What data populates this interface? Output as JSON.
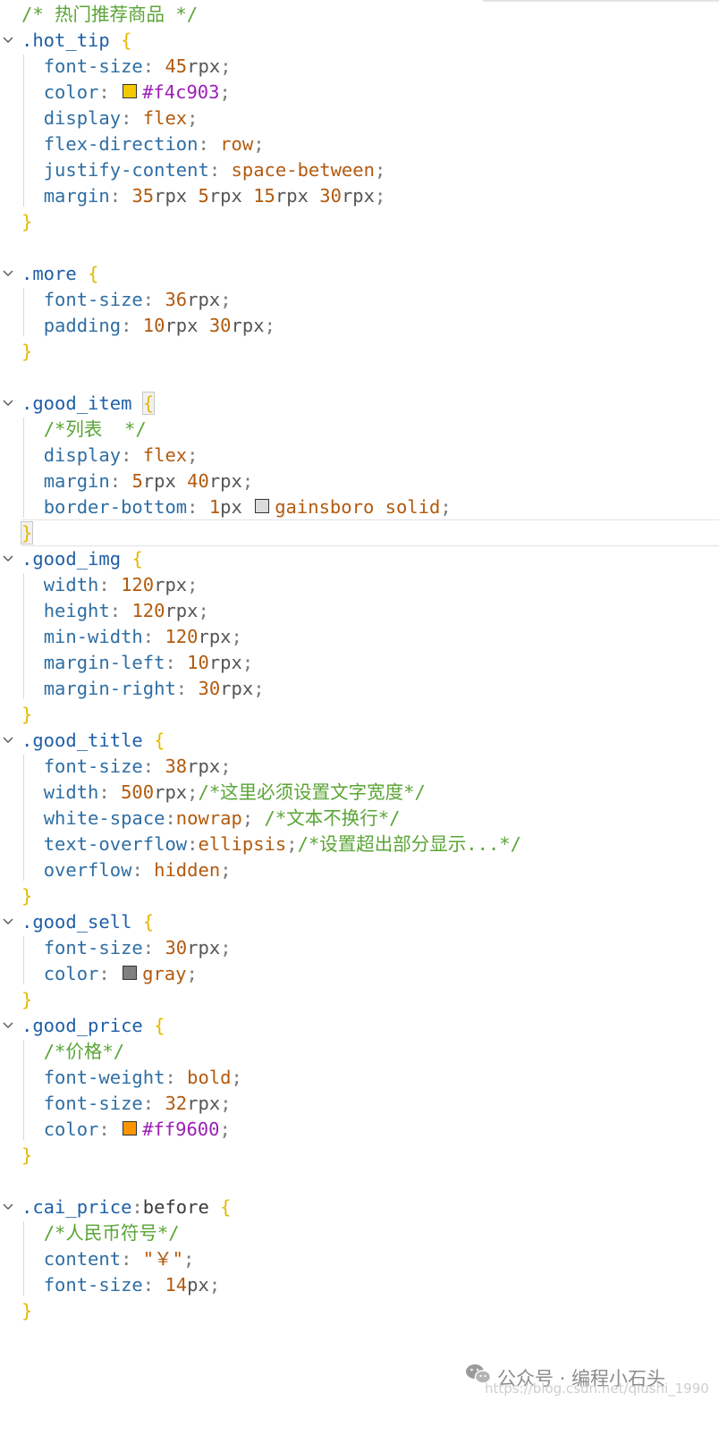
{
  "lines": [
    {
      "top": 0,
      "fold": false,
      "segs": [
        [
          "c-comment",
          "/* 热门推荐商品 */"
        ]
      ]
    },
    {
      "top": 0,
      "fold": true,
      "segs": [
        [
          "c-selector",
          ".hot_tip"
        ],
        [
          "c-plain",
          " "
        ],
        [
          "c-brace",
          "{"
        ]
      ]
    },
    {
      "top": 0,
      "fold": false,
      "segs": [
        [
          "c-plain",
          "  "
        ],
        [
          "c-prop",
          "font-size"
        ],
        [
          "c-punct",
          ": "
        ],
        [
          "c-number",
          "45"
        ],
        [
          "c-unit",
          "rpx"
        ],
        [
          "c-punct",
          ";"
        ]
      ]
    },
    {
      "top": 0,
      "fold": false,
      "segs": [
        [
          "c-plain",
          "  "
        ],
        [
          "c-prop",
          "color"
        ],
        [
          "c-punct",
          ": "
        ],
        [
          "swatch",
          "#f4c903"
        ],
        [
          "c-hex",
          "#f4c903"
        ],
        [
          "c-punct",
          ";"
        ]
      ]
    },
    {
      "top": 0,
      "fold": false,
      "segs": [
        [
          "c-plain",
          "  "
        ],
        [
          "c-prop",
          "display"
        ],
        [
          "c-punct",
          ": "
        ],
        [
          "c-value",
          "flex"
        ],
        [
          "c-punct",
          ";"
        ]
      ]
    },
    {
      "top": 0,
      "fold": false,
      "segs": [
        [
          "c-plain",
          "  "
        ],
        [
          "c-prop",
          "flex-direction"
        ],
        [
          "c-punct",
          ": "
        ],
        [
          "c-value",
          "row"
        ],
        [
          "c-punct",
          ";"
        ]
      ]
    },
    {
      "top": 0,
      "fold": false,
      "segs": [
        [
          "c-plain",
          "  "
        ],
        [
          "c-prop",
          "justify-content"
        ],
        [
          "c-punct",
          ": "
        ],
        [
          "c-value",
          "space-between"
        ],
        [
          "c-punct",
          ";"
        ]
      ]
    },
    {
      "top": 0,
      "fold": false,
      "segs": [
        [
          "c-plain",
          "  "
        ],
        [
          "c-prop",
          "margin"
        ],
        [
          "c-punct",
          ": "
        ],
        [
          "c-number",
          "35"
        ],
        [
          "c-unit",
          "rpx "
        ],
        [
          "c-number",
          "5"
        ],
        [
          "c-unit",
          "rpx "
        ],
        [
          "c-number",
          "15"
        ],
        [
          "c-unit",
          "rpx "
        ],
        [
          "c-number",
          "30"
        ],
        [
          "c-unit",
          "rpx"
        ],
        [
          "c-punct",
          ";"
        ]
      ]
    },
    {
      "top": 0,
      "fold": false,
      "segs": [
        [
          "c-brace",
          "}"
        ]
      ]
    },
    {
      "top": 0,
      "fold": false,
      "segs": []
    },
    {
      "top": 0,
      "fold": true,
      "segs": [
        [
          "c-selector",
          ".more"
        ],
        [
          "c-plain",
          " "
        ],
        [
          "c-brace",
          "{"
        ]
      ]
    },
    {
      "top": 0,
      "fold": false,
      "segs": [
        [
          "c-plain",
          "  "
        ],
        [
          "c-prop",
          "font-size"
        ],
        [
          "c-punct",
          ": "
        ],
        [
          "c-number",
          "36"
        ],
        [
          "c-unit",
          "rpx"
        ],
        [
          "c-punct",
          ";"
        ]
      ]
    },
    {
      "top": 0,
      "fold": false,
      "segs": [
        [
          "c-plain",
          "  "
        ],
        [
          "c-prop",
          "padding"
        ],
        [
          "c-punct",
          ": "
        ],
        [
          "c-number",
          "10"
        ],
        [
          "c-unit",
          "rpx "
        ],
        [
          "c-number",
          "30"
        ],
        [
          "c-unit",
          "rpx"
        ],
        [
          "c-punct",
          ";"
        ]
      ]
    },
    {
      "top": 0,
      "fold": false,
      "segs": [
        [
          "c-brace",
          "}"
        ]
      ]
    },
    {
      "top": 0,
      "fold": false,
      "segs": []
    },
    {
      "top": 0,
      "fold": true,
      "segs": [
        [
          "c-selector",
          ".good_item"
        ],
        [
          "c-plain",
          " "
        ],
        [
          "c-brace-hl",
          "{"
        ]
      ]
    },
    {
      "top": 0,
      "fold": false,
      "segs": [
        [
          "c-plain",
          "  "
        ],
        [
          "c-comment",
          "/*列表  */"
        ]
      ]
    },
    {
      "top": 0,
      "fold": false,
      "segs": [
        [
          "c-plain",
          "  "
        ],
        [
          "c-prop",
          "display"
        ],
        [
          "c-punct",
          ": "
        ],
        [
          "c-value",
          "flex"
        ],
        [
          "c-punct",
          ";"
        ]
      ]
    },
    {
      "top": 0,
      "fold": false,
      "segs": [
        [
          "c-plain",
          "  "
        ],
        [
          "c-prop",
          "margin"
        ],
        [
          "c-punct",
          ": "
        ],
        [
          "c-number",
          "5"
        ],
        [
          "c-unit",
          "rpx "
        ],
        [
          "c-number",
          "40"
        ],
        [
          "c-unit",
          "rpx"
        ],
        [
          "c-punct",
          ";"
        ]
      ]
    },
    {
      "top": 0,
      "fold": false,
      "segs": [
        [
          "c-plain",
          "  "
        ],
        [
          "c-prop",
          "border-bottom"
        ],
        [
          "c-punct",
          ": "
        ],
        [
          "c-number",
          "1"
        ],
        [
          "c-unit",
          "px "
        ],
        [
          "swatch",
          "#dcdcdc"
        ],
        [
          "c-value",
          "gainsboro solid"
        ],
        [
          "c-punct",
          ";"
        ]
      ]
    },
    {
      "top": 0,
      "fold": false,
      "segs": [
        [
          "c-brace-hl",
          "}"
        ]
      ]
    },
    {
      "top": 0,
      "fold": true,
      "segs": [
        [
          "c-selector",
          ".good_img"
        ],
        [
          "c-plain",
          " "
        ],
        [
          "c-brace",
          "{"
        ]
      ]
    },
    {
      "top": 0,
      "fold": false,
      "segs": [
        [
          "c-plain",
          "  "
        ],
        [
          "c-prop",
          "width"
        ],
        [
          "c-punct",
          ": "
        ],
        [
          "c-number",
          "120"
        ],
        [
          "c-unit",
          "rpx"
        ],
        [
          "c-punct",
          ";"
        ]
      ]
    },
    {
      "top": 0,
      "fold": false,
      "segs": [
        [
          "c-plain",
          "  "
        ],
        [
          "c-prop",
          "height"
        ],
        [
          "c-punct",
          ": "
        ],
        [
          "c-number",
          "120"
        ],
        [
          "c-unit",
          "rpx"
        ],
        [
          "c-punct",
          ";"
        ]
      ]
    },
    {
      "top": 0,
      "fold": false,
      "segs": [
        [
          "c-plain",
          "  "
        ],
        [
          "c-prop",
          "min-width"
        ],
        [
          "c-punct",
          ": "
        ],
        [
          "c-number",
          "120"
        ],
        [
          "c-unit",
          "rpx"
        ],
        [
          "c-punct",
          ";"
        ]
      ]
    },
    {
      "top": 0,
      "fold": false,
      "segs": [
        [
          "c-plain",
          "  "
        ],
        [
          "c-prop",
          "margin-left"
        ],
        [
          "c-punct",
          ": "
        ],
        [
          "c-number",
          "10"
        ],
        [
          "c-unit",
          "rpx"
        ],
        [
          "c-punct",
          ";"
        ]
      ]
    },
    {
      "top": 0,
      "fold": false,
      "segs": [
        [
          "c-plain",
          "  "
        ],
        [
          "c-prop",
          "margin-right"
        ],
        [
          "c-punct",
          ": "
        ],
        [
          "c-number",
          "30"
        ],
        [
          "c-unit",
          "rpx"
        ],
        [
          "c-punct",
          ";"
        ]
      ]
    },
    {
      "top": 0,
      "fold": false,
      "segs": [
        [
          "c-brace",
          "}"
        ]
      ]
    },
    {
      "top": 0,
      "fold": true,
      "segs": [
        [
          "c-selector",
          ".good_title"
        ],
        [
          "c-plain",
          " "
        ],
        [
          "c-brace",
          "{"
        ]
      ]
    },
    {
      "top": 0,
      "fold": false,
      "segs": [
        [
          "c-plain",
          "  "
        ],
        [
          "c-prop",
          "font-size"
        ],
        [
          "c-punct",
          ": "
        ],
        [
          "c-number",
          "38"
        ],
        [
          "c-unit",
          "rpx"
        ],
        [
          "c-punct",
          ";"
        ]
      ]
    },
    {
      "top": 0,
      "fold": false,
      "segs": [
        [
          "c-plain",
          "  "
        ],
        [
          "c-prop",
          "width"
        ],
        [
          "c-punct",
          ": "
        ],
        [
          "c-number",
          "500"
        ],
        [
          "c-unit",
          "rpx"
        ],
        [
          "c-punct",
          ";"
        ],
        [
          "c-comment",
          "/*这里必须设置文字宽度*/"
        ]
      ]
    },
    {
      "top": 0,
      "fold": false,
      "segs": [
        [
          "c-plain",
          "  "
        ],
        [
          "c-prop",
          "white-space"
        ],
        [
          "c-punct",
          ":"
        ],
        [
          "c-value",
          "nowrap"
        ],
        [
          "c-punct",
          "; "
        ],
        [
          "c-comment",
          "/*文本不换行*/"
        ]
      ]
    },
    {
      "top": 0,
      "fold": false,
      "segs": [
        [
          "c-plain",
          "  "
        ],
        [
          "c-prop",
          "text-overflow"
        ],
        [
          "c-punct",
          ":"
        ],
        [
          "c-value",
          "ellipsis"
        ],
        [
          "c-punct",
          ";"
        ],
        [
          "c-comment",
          "/*设置超出部分显示...*/"
        ]
      ]
    },
    {
      "top": 0,
      "fold": false,
      "segs": [
        [
          "c-plain",
          "  "
        ],
        [
          "c-prop",
          "overflow"
        ],
        [
          "c-punct",
          ": "
        ],
        [
          "c-value",
          "hidden"
        ],
        [
          "c-punct",
          ";"
        ]
      ]
    },
    {
      "top": 0,
      "fold": false,
      "segs": [
        [
          "c-brace",
          "}"
        ]
      ]
    },
    {
      "top": 0,
      "fold": true,
      "segs": [
        [
          "c-selector",
          ".good_sell"
        ],
        [
          "c-plain",
          " "
        ],
        [
          "c-brace",
          "{"
        ]
      ]
    },
    {
      "top": 0,
      "fold": false,
      "segs": [
        [
          "c-plain",
          "  "
        ],
        [
          "c-prop",
          "font-size"
        ],
        [
          "c-punct",
          ": "
        ],
        [
          "c-number",
          "30"
        ],
        [
          "c-unit",
          "rpx"
        ],
        [
          "c-punct",
          ";"
        ]
      ]
    },
    {
      "top": 0,
      "fold": false,
      "segs": [
        [
          "c-plain",
          "  "
        ],
        [
          "c-prop",
          "color"
        ],
        [
          "c-punct",
          ": "
        ],
        [
          "swatch",
          "#808080"
        ],
        [
          "c-value",
          "gray"
        ],
        [
          "c-punct",
          ";"
        ]
      ]
    },
    {
      "top": 0,
      "fold": false,
      "segs": [
        [
          "c-brace",
          "}"
        ]
      ]
    },
    {
      "top": 0,
      "fold": true,
      "segs": [
        [
          "c-selector",
          ".good_price"
        ],
        [
          "c-plain",
          " "
        ],
        [
          "c-brace",
          "{"
        ]
      ]
    },
    {
      "top": 0,
      "fold": false,
      "segs": [
        [
          "c-plain",
          "  "
        ],
        [
          "c-comment",
          "/*价格*/"
        ]
      ]
    },
    {
      "top": 0,
      "fold": false,
      "segs": [
        [
          "c-plain",
          "  "
        ],
        [
          "c-prop",
          "font-weight"
        ],
        [
          "c-punct",
          ": "
        ],
        [
          "c-value",
          "bold"
        ],
        [
          "c-punct",
          ";"
        ]
      ]
    },
    {
      "top": 0,
      "fold": false,
      "segs": [
        [
          "c-plain",
          "  "
        ],
        [
          "c-prop",
          "font-size"
        ],
        [
          "c-punct",
          ": "
        ],
        [
          "c-number",
          "32"
        ],
        [
          "c-unit",
          "rpx"
        ],
        [
          "c-punct",
          ";"
        ]
      ]
    },
    {
      "top": 0,
      "fold": false,
      "segs": [
        [
          "c-plain",
          "  "
        ],
        [
          "c-prop",
          "color"
        ],
        [
          "c-punct",
          ": "
        ],
        [
          "swatch",
          "#ff9600"
        ],
        [
          "c-hex",
          "#ff9600"
        ],
        [
          "c-punct",
          ";"
        ]
      ]
    },
    {
      "top": 0,
      "fold": false,
      "segs": [
        [
          "c-brace",
          "}"
        ]
      ]
    },
    {
      "top": 0,
      "fold": false,
      "segs": []
    },
    {
      "top": 0,
      "fold": true,
      "segs": [
        [
          "c-selector",
          ".cai_price"
        ],
        [
          "c-punct",
          ":"
        ],
        [
          "c-plain",
          "before "
        ],
        [
          "c-brace",
          "{"
        ]
      ]
    },
    {
      "top": 0,
      "fold": false,
      "segs": [
        [
          "c-plain",
          "  "
        ],
        [
          "c-comment",
          "/*人民币符号*/"
        ]
      ]
    },
    {
      "top": 0,
      "fold": false,
      "segs": [
        [
          "c-plain",
          "  "
        ],
        [
          "c-prop",
          "content"
        ],
        [
          "c-punct",
          ": "
        ],
        [
          "c-value",
          "\"￥\""
        ],
        [
          "c-punct",
          ";"
        ]
      ]
    },
    {
      "top": 0,
      "fold": false,
      "segs": [
        [
          "c-plain",
          "  "
        ],
        [
          "c-prop",
          "font-size"
        ],
        [
          "c-punct",
          ": "
        ],
        [
          "c-number",
          "14"
        ],
        [
          "c-unit",
          "px"
        ],
        [
          "c-punct",
          ";"
        ]
      ]
    },
    {
      "top": 0,
      "fold": false,
      "segs": [
        [
          "c-brace",
          "}"
        ]
      ]
    }
  ],
  "watermark": {
    "text": "公众号 · 编程小石头",
    "url": "https://blog.csdn.net/qiushi_1990",
    "icon": "wechat-icon"
  },
  "colors": {
    "comment": "#5aa536",
    "selector": "#1f5fa8",
    "property": "#2f6ea3",
    "value": "#b25a0e",
    "hex": "#9b20b5",
    "brace": "#e6b800"
  }
}
